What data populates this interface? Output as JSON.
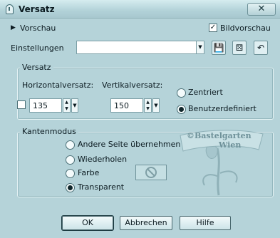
{
  "window": {
    "title": "Versatz",
    "close_label": "✕"
  },
  "toolbar": {
    "preview_label": "Vorschau",
    "image_preview_label": "Bildvorschau",
    "image_preview_checked": true,
    "settings_label": "Einstellungen",
    "settings_value": ""
  },
  "offset": {
    "group_label": "Versatz",
    "horizontal_label": "Horizontalversatz:",
    "horizontal_value": "135",
    "vertical_label": "Vertikalversatz:",
    "vertical_value": "150",
    "centered_label": "Zentriert",
    "custom_label": "Benutzerdefiniert",
    "selected": "custom"
  },
  "edge_mode": {
    "group_label": "Kantenmodus",
    "options": [
      "Andere Seite übernehmen",
      "Wiederholen",
      "Farbe",
      "Transparent"
    ],
    "selected": "Transparent"
  },
  "watermark": {
    "line1": "©Bastelgarten",
    "line2": "Wien"
  },
  "buttons": {
    "ok": "OK",
    "cancel": "Abbrechen",
    "help": "Hilfe"
  },
  "colors": {
    "background": "#b5d3d9",
    "accent": "#1c3a40"
  }
}
